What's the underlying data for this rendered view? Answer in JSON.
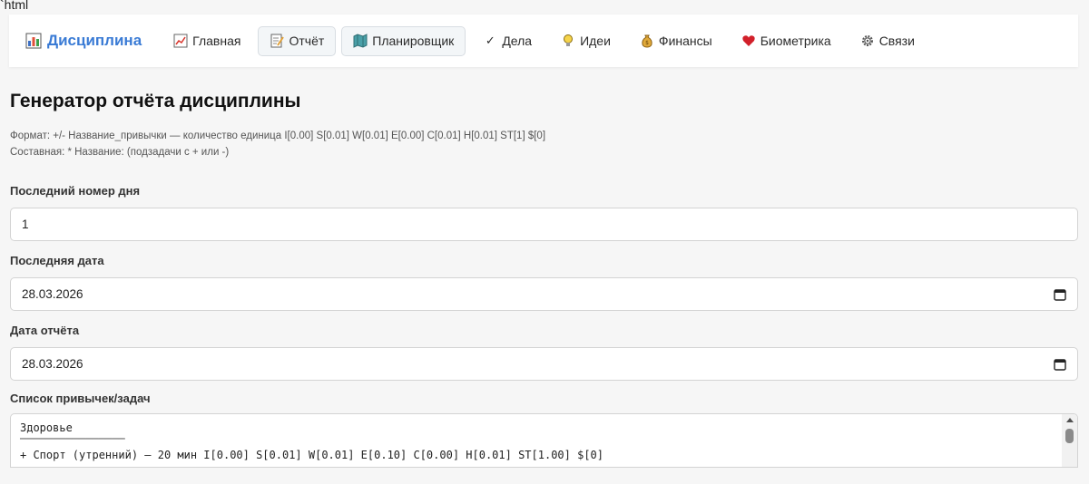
{
  "artifact_text": "`html",
  "nav": {
    "brand": "Дисциплина",
    "items": [
      {
        "label": "Главная",
        "icon": "chart-up-icon",
        "active": false
      },
      {
        "label": "Отчёт",
        "icon": "memo-icon",
        "active": true
      },
      {
        "label": "Планировщик",
        "icon": "map-icon",
        "active": true
      },
      {
        "label": "Дела",
        "icon": "check-icon",
        "active": false
      },
      {
        "label": "Идеи",
        "icon": "lightbulb-icon",
        "active": false
      },
      {
        "label": "Финансы",
        "icon": "money-bag-icon",
        "active": false
      },
      {
        "label": "Биометрика",
        "icon": "heart-icon",
        "active": false
      },
      {
        "label": "Связи",
        "icon": "gear-icon",
        "active": false
      }
    ]
  },
  "page": {
    "title": "Генератор отчёта дисциплины",
    "hint_format": "Формат: +/- Название_привычки — количество единица I[0.00] S[0.01] W[0.01] E[0.00] C[0.01] H[0.01] ST[1] $[0]",
    "hint_composite": "Составная: * Название: (подзадачи с + или -)"
  },
  "form": {
    "last_day_label": "Последний номер дня",
    "last_day_value": "1",
    "last_date_label": "Последняя дата",
    "last_date_value": "28.03.2026",
    "report_date_label": "Дата отчёта",
    "report_date_value": "28.03.2026",
    "habits_label": "Список привычек/задач",
    "habits_lines": [
      "Здоровье",
      "────────────────",
      "+ Спорт (утренний) — 20 мин I[0.00] S[0.01] W[0.01] E[0.10] C[0.00] H[0.01] ST[1.00] $[0]"
    ]
  },
  "colors": {
    "brand": "#3a7bd5",
    "page_bg": "#f6f6f6"
  }
}
